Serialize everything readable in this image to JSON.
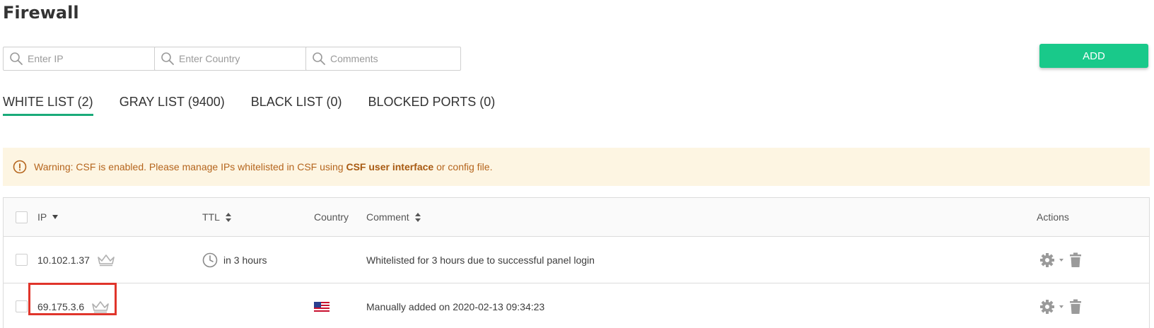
{
  "page": {
    "title": "Firewall"
  },
  "filters": {
    "ip_placeholder": "Enter IP",
    "country_placeholder": "Enter Country",
    "comments_placeholder": "Comments"
  },
  "toolbar": {
    "add_label": "ADD",
    "add_color": "#19c98a"
  },
  "tabs": [
    {
      "label": "WHITE LIST (2)",
      "active": true
    },
    {
      "label": "GRAY LIST (9400)",
      "active": false
    },
    {
      "label": "BLACK LIST (0)",
      "active": false
    },
    {
      "label": "BLOCKED PORTS (0)",
      "active": false
    }
  ],
  "warning": {
    "prefix": "Warning: CSF is enabled. Please manage IPs whitelisted in CSF using ",
    "link": "CSF user interface",
    "suffix": " or config file.",
    "color": "#b5651d",
    "background": "#fdf5e2"
  },
  "table": {
    "columns": {
      "ip": "IP",
      "ttl": "TTL",
      "country": "Country",
      "comment": "Comment",
      "actions": "Actions"
    },
    "rows": [
      {
        "ip": "10.102.1.37",
        "ttl": "in 3 hours",
        "country": "",
        "comment": "Whitelisted for 3 hours due to successful panel login"
      },
      {
        "ip": "69.175.3.6",
        "ttl": "",
        "country": "us-flag-icon",
        "comment": "Manually added on 2020-02-13 09:34:23"
      }
    ]
  },
  "icons": {
    "search": "search-icon",
    "crown": "crown-icon",
    "clock": "clock-icon",
    "gear": "gear-icon",
    "trash": "trash-icon",
    "warning": "info-circle-icon",
    "flag": "us-flag-icon"
  },
  "accent_colors": {
    "tab_underline": "#1aab7a",
    "highlight_box": "#e0352b"
  }
}
